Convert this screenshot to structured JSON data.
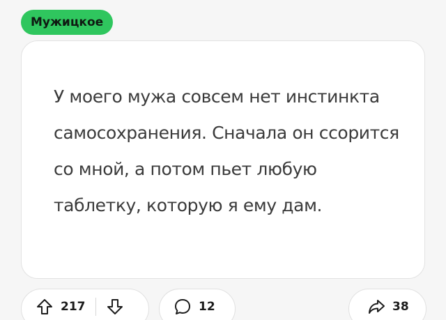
{
  "post": {
    "tag": "Мужицкое",
    "text": "У моего мужа совсем нет инстинкта самосохранения. Сначала он ссорится со мной, а потом пьет любую таблетку, которую я ему дам."
  },
  "actions": {
    "upvotes": "217",
    "comments": "12",
    "shares": "38"
  },
  "colors": {
    "tag_bg": "#2fc65e",
    "card_bg": "#ffffff",
    "text": "#3a3a3a"
  }
}
